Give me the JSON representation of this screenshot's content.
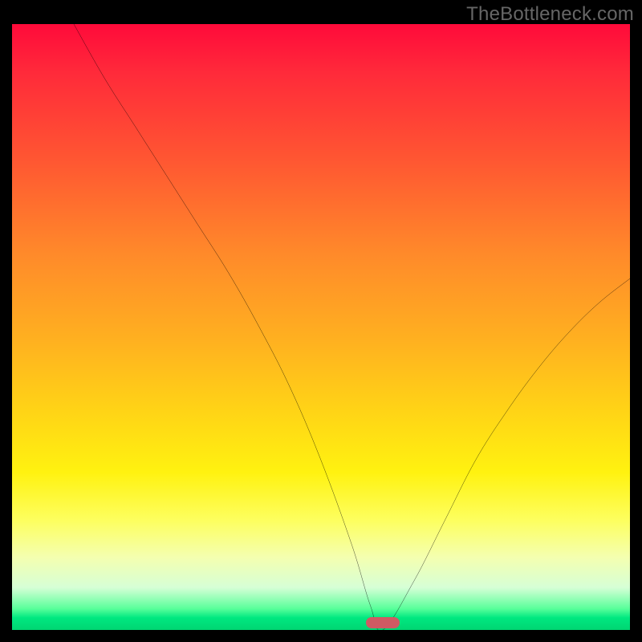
{
  "watermark": "TheBottleneck.com",
  "chart_data": {
    "type": "line",
    "title": "",
    "xlabel": "",
    "ylabel": "",
    "xlim": [
      0,
      100
    ],
    "ylim": [
      0,
      100
    ],
    "x": [
      10,
      15,
      20,
      25,
      30,
      35,
      40,
      45,
      50,
      55,
      58,
      60,
      65,
      70,
      75,
      80,
      85,
      90,
      95,
      100
    ],
    "values": [
      100,
      91,
      83,
      75,
      67,
      59,
      50,
      40,
      28,
      14,
      4,
      0,
      8,
      18,
      28,
      36,
      43,
      49,
      54,
      58
    ],
    "marker_x": 60,
    "gradient_stops": [
      {
        "pos": 0,
        "color": "#ff0a3a"
      },
      {
        "pos": 50,
        "color": "#ffc41a"
      },
      {
        "pos": 80,
        "color": "#fcff4a"
      },
      {
        "pos": 100,
        "color": "#00d572"
      }
    ],
    "curve_color": "#000000",
    "marker_color": "#cf5a63",
    "frame_color": "#000000"
  }
}
